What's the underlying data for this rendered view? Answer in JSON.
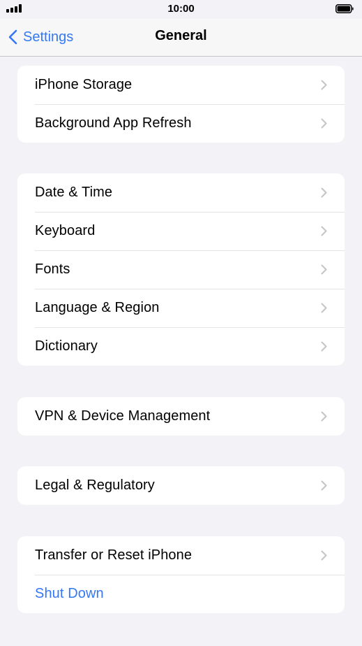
{
  "status_bar": {
    "time": "10:00",
    "signal_icon": "cellular-signal-icon",
    "battery_icon": "battery-full-icon"
  },
  "nav": {
    "back_label": "Settings",
    "title": "General"
  },
  "groups": [
    {
      "items": [
        {
          "label": "iPhone Storage"
        },
        {
          "label": "Background App Refresh"
        }
      ]
    },
    {
      "items": [
        {
          "label": "Date & Time"
        },
        {
          "label": "Keyboard"
        },
        {
          "label": "Fonts"
        },
        {
          "label": "Language & Region"
        },
        {
          "label": "Dictionary"
        }
      ]
    },
    {
      "items": [
        {
          "label": "VPN & Device Management"
        }
      ]
    },
    {
      "items": [
        {
          "label": "Legal & Regulatory"
        }
      ]
    },
    {
      "items": [
        {
          "label": "Transfer or Reset iPhone"
        },
        {
          "label": "Shut Down"
        }
      ]
    }
  ],
  "colors": {
    "accent": "#3478f6",
    "background": "#f2f2f7",
    "cell": "#ffffff",
    "chevron": "#c4c4c7"
  }
}
